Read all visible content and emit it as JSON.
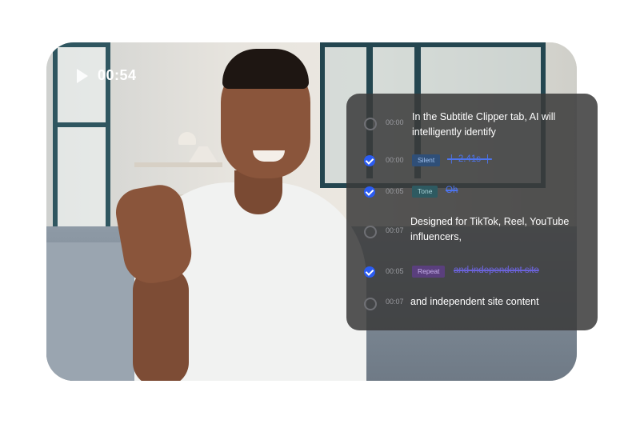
{
  "video": {
    "time": "00:54"
  },
  "subtitles": [
    {
      "checked": false,
      "timestamp": "00:00",
      "text": "In the Subtitle Clipper tab, AI will intelligently identify"
    },
    {
      "checked": true,
      "timestamp": "00:00",
      "tag": "Silent",
      "removed_text": "·|· 2.41s ·|·"
    },
    {
      "checked": true,
      "timestamp": "00:05",
      "tag": "Tone",
      "removed_text": "Oh"
    },
    {
      "checked": false,
      "timestamp": "00:07",
      "text": "Designed for TikTok, Reel, YouTube influencers,"
    },
    {
      "checked": true,
      "timestamp": "00:05",
      "tag": "Repeat",
      "removed_text": "and independent site"
    },
    {
      "checked": false,
      "timestamp": "00:07",
      "text": "and independent site content"
    }
  ],
  "colors": {
    "checkbox_active": "#2b5cf2",
    "tag_silent": "#2f4f78",
    "tag_tone": "#2e5a61",
    "tag_repeat": "#5a3f7d",
    "panel_bg": "#3a3a3a"
  },
  "icons": {
    "play": "play-icon",
    "check": "checkmark-icon"
  }
}
